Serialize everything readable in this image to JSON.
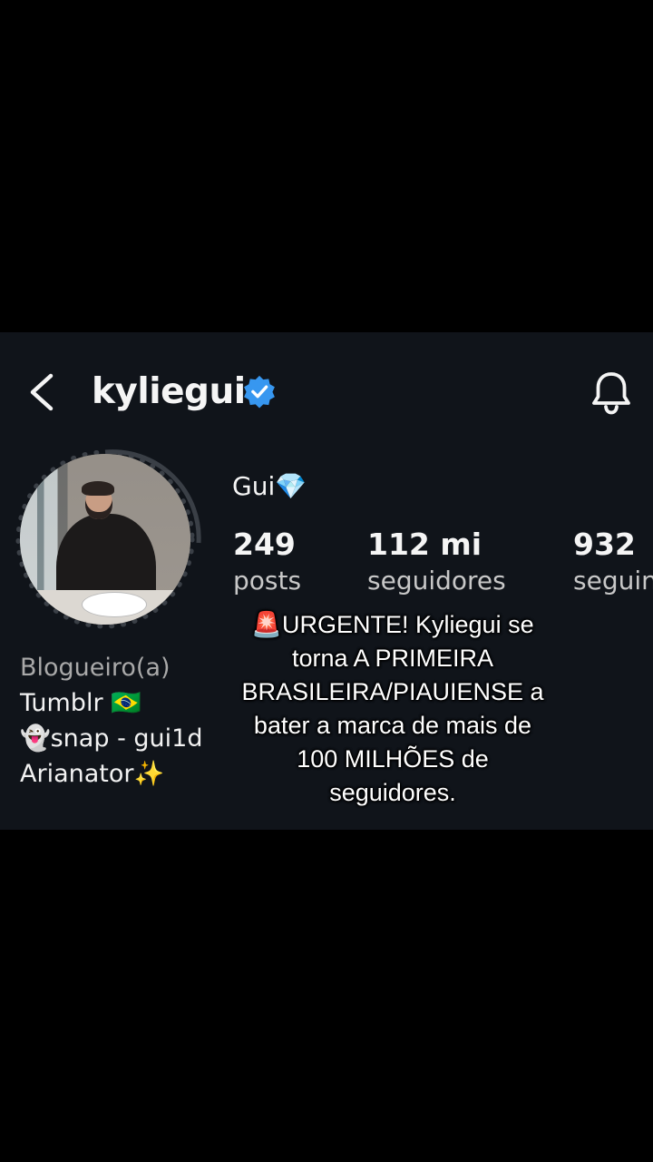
{
  "header": {
    "username": "kyliegui",
    "verified_icon": "verified-badge-icon",
    "back_icon": "chevron-left-icon",
    "bell_icon": "bell-icon"
  },
  "profile": {
    "display_name": "Gui💎",
    "stats": [
      {
        "value": "249",
        "label": "posts"
      },
      {
        "value": "112 mi",
        "label": "seguidores"
      },
      {
        "value": "932",
        "label": "seguin"
      }
    ],
    "bio": {
      "category": "Blogueiro(a)",
      "lines": [
        "Tumblr 🇧🇷",
        "👻snap - gui1d",
        "Arianator✨"
      ]
    }
  },
  "caption": {
    "lines": [
      "🚨URGENTE! Kyliegui se",
      "torna A PRIMEIRA",
      "BRASILEIRA/PIAUIENSE a",
      "bater a marca de mais de",
      "100 MILHÕES de",
      "seguidores."
    ]
  },
  "colors": {
    "background": "#000000",
    "card": "#10141a",
    "verified": "#3797f0",
    "text": "#f5f5f5",
    "muted": "#a9a9a9"
  }
}
